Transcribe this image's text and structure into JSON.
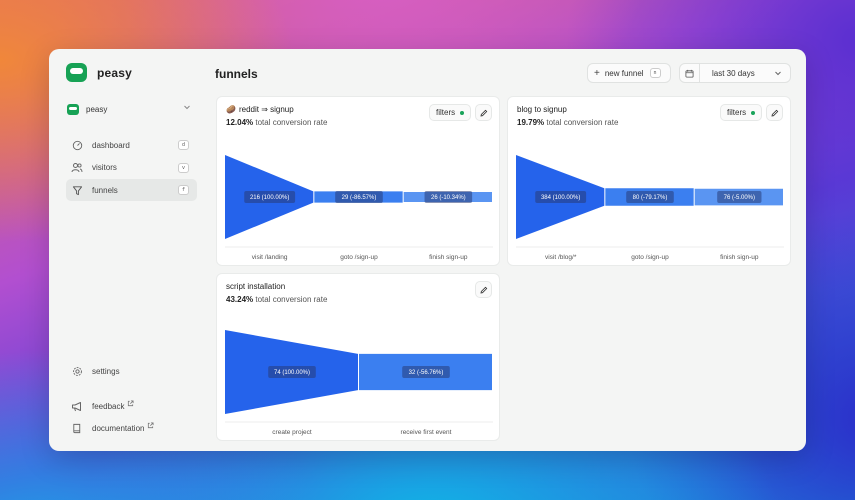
{
  "app": {
    "name": "peasy"
  },
  "project": {
    "name": "peasy"
  },
  "nav": [
    {
      "label": "dashboard",
      "shortcut": "d",
      "icon": "dashboard-icon",
      "active": false
    },
    {
      "label": "visitors",
      "shortcut": "v",
      "icon": "visitors-icon",
      "active": false
    },
    {
      "label": "funnels",
      "shortcut": "f",
      "icon": "funnel-icon",
      "active": true
    }
  ],
  "bottom_nav": {
    "settings": "settings",
    "feedback": "feedback",
    "documentation": "documentation"
  },
  "header": {
    "title": "funnels",
    "new_funnel_label": "new funnel",
    "new_funnel_shortcut": "n",
    "date_range": "last 30 days"
  },
  "colors": {
    "brand": "#17a255",
    "funnel_primary": "#2563eb",
    "funnel_secondary": "#3b7ff0",
    "funnel_tertiary": "#5a95f2"
  },
  "funnels": [
    {
      "emoji": "🥔",
      "title": "reddit ⇒ signup",
      "rate": "12.04%",
      "rate_suffix": " total conversion rate",
      "filters_label": "filters",
      "chart_data": {
        "type": "funnel",
        "categories": [
          "visit /landing",
          "goto /sign-up",
          "finish sign-up"
        ],
        "values": [
          216,
          29,
          26
        ],
        "labels": [
          "216 (100.00%)",
          "29 (-86.57%)",
          "26 (-10.34%)"
        ]
      }
    },
    {
      "emoji": "",
      "title": "blog to signup",
      "rate": "19.79%",
      "rate_suffix": " total conversion rate",
      "filters_label": "filters",
      "chart_data": {
        "type": "funnel",
        "categories": [
          "visit /blog/*",
          "goto /sign-up",
          "finish sign-up"
        ],
        "values": [
          384,
          80,
          76
        ],
        "labels": [
          "384 (100.00%)",
          "80 (-79.17%)",
          "76 (-5.00%)"
        ]
      }
    },
    {
      "emoji": "",
      "title": "script installation",
      "rate": "43.24%",
      "rate_suffix": " total conversion rate",
      "filters_label": "",
      "chart_data": {
        "type": "funnel",
        "categories": [
          "create project",
          "receive first event"
        ],
        "values": [
          74,
          32
        ],
        "labels": [
          "74 (100.00%)",
          "32 (-56.76%)"
        ]
      }
    }
  ]
}
